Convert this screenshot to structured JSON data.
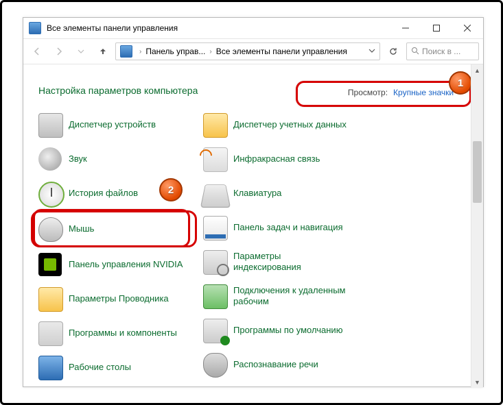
{
  "titlebar": {
    "title": "Все элементы панели управления"
  },
  "breadcrumb": {
    "b1": "Панель управ...",
    "b2": "Все элементы панели управления"
  },
  "search": {
    "placeholder": "Поиск в ..."
  },
  "header": {
    "page_title": "Настройка параметров компьютера",
    "view_label": "Просмотр:",
    "view_value": "Крупные значки"
  },
  "items_left": [
    {
      "label": "Диспетчер устройств",
      "icon": "device-manager-icon"
    },
    {
      "label": "Звук",
      "icon": "sound-icon"
    },
    {
      "label": "История файлов",
      "icon": "file-history-icon"
    },
    {
      "label": "Мышь",
      "icon": "mouse-icon"
    },
    {
      "label": "Панель управления NVIDIA",
      "icon": "nvidia-icon"
    },
    {
      "label": "Параметры Проводника",
      "icon": "explorer-options-icon"
    },
    {
      "label": "Программы и компоненты",
      "icon": "programs-features-icon"
    },
    {
      "label": "Рабочие столы",
      "icon": "desktops-icon"
    }
  ],
  "items_right": [
    {
      "label": "Диспетчер учетных данных",
      "icon": "credential-manager-icon"
    },
    {
      "label": "Инфракрасная связь",
      "icon": "infrared-icon"
    },
    {
      "label": "Клавиатура",
      "icon": "keyboard-icon"
    },
    {
      "label": "Панель задач и навигация",
      "icon": "taskbar-nav-icon"
    },
    {
      "label": "Параметры индексирования",
      "icon": "indexing-options-icon"
    },
    {
      "label": "Подключения к удаленным рабочим",
      "icon": "remote-desktop-icon"
    },
    {
      "label": "Программы по умолчанию",
      "icon": "default-programs-icon"
    },
    {
      "label": "Распознавание речи",
      "icon": "speech-recognition-icon"
    }
  ],
  "callouts": {
    "c1": "1",
    "c2": "2"
  }
}
